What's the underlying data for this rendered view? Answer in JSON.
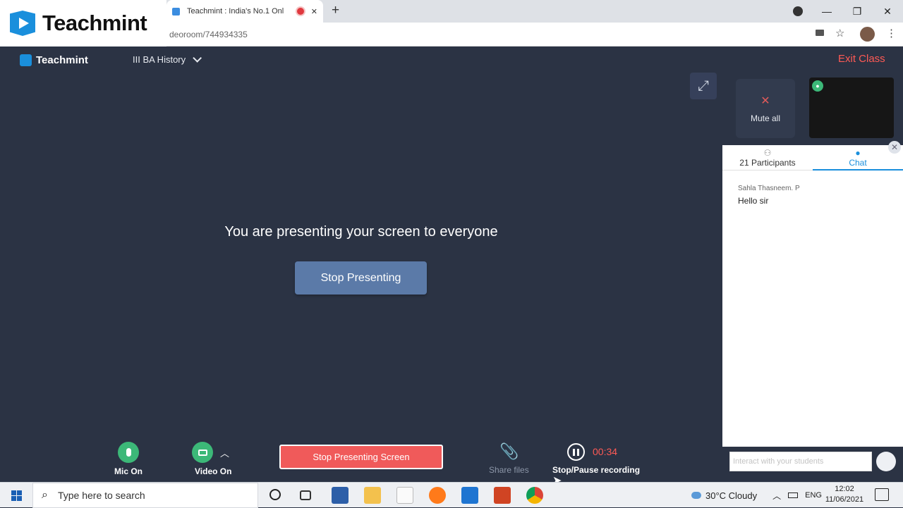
{
  "browser": {
    "tab_title": "Teachmint : India's No.1 Onl",
    "address": "deoroom/744934335",
    "new_tab": "+",
    "close_tab": "✕",
    "minimize": "—",
    "restore": "❐",
    "close": "✕"
  },
  "logo_overlay": {
    "text": "Teachmint"
  },
  "app_header": {
    "logo_text": "Teachmint",
    "class_name": "III BA History",
    "exit_label": "Exit Class"
  },
  "main": {
    "presenting_message": "You are presenting your screen to everyone",
    "stop_presenting_label": "Stop Presenting",
    "expand_icon": "⤢"
  },
  "tiles": {
    "mute_all_label": "Mute all",
    "mic_off_icon": "🎙"
  },
  "side_panel": {
    "participants_label": "21 Participants",
    "chat_label": "Chat",
    "close_icon": "✕",
    "messages": [
      {
        "sender": "Sahla Thasneem. P",
        "text": "Hello sir"
      }
    ],
    "input_placeholder": "Interact with your students"
  },
  "controls": {
    "mic_label": "Mic On",
    "video_label": "Video On",
    "stop_screen_label": "Stop Presenting Screen",
    "share_label": "Share files",
    "record_time": "00:34",
    "record_label": "Stop/Pause recording"
  },
  "taskbar": {
    "search_placeholder": "Type here to search",
    "weather": "30°C  Cloudy",
    "lang": "ENG",
    "time": "12:02",
    "date": "11/06/2021"
  },
  "colors": {
    "background": "#2b3344",
    "accent_blue": "#1a8fdc",
    "green": "#3cb878",
    "red": "#f05a5a"
  }
}
